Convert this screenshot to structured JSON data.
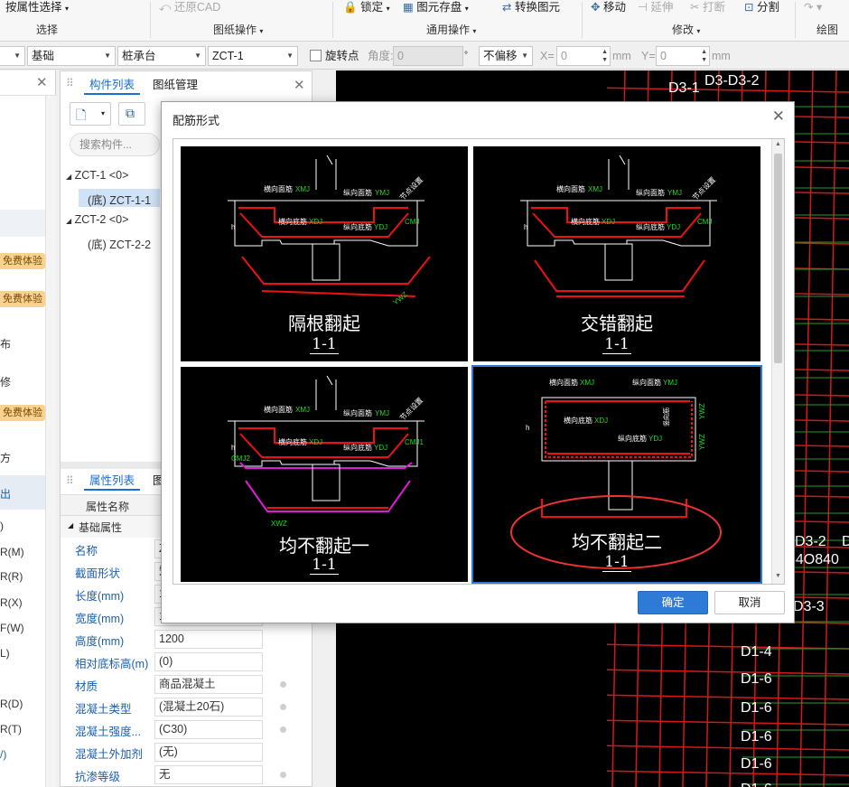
{
  "ribbon": {
    "attr_select": "按属性选择",
    "restore_cad": "还原CAD",
    "lock": "锁定",
    "save_elem": "图元存盘",
    "convert_elem": "转换图元",
    "move": "移动",
    "extend": "延伸",
    "break": "打断",
    "split": "分割",
    "groups": {
      "select": "选择",
      "drawing": "图纸操作",
      "common": "通用操作",
      "modify": "修改",
      "draw": "绘图"
    }
  },
  "toolbar": {
    "category": "基础",
    "type": "桩承台",
    "element": "ZCT-1",
    "rotate_point": "旋转点",
    "angle_label": "角度:",
    "angle_value": "0",
    "offset": "不偏移",
    "x_label": "X=",
    "x_value": "0",
    "y_label": "Y=",
    "y_value": "0",
    "unit": "mm"
  },
  "left_strip": {
    "badge": "免费体验",
    "items": [
      "布",
      "修",
      "方",
      "出",
      ")",
      "R(M)",
      "R(R)",
      "R(X)",
      "F(W)",
      "L)",
      "R(D)",
      "R(T)",
      "/)"
    ]
  },
  "component_panel": {
    "tabs": [
      "构件列表",
      "图纸管理"
    ],
    "search_placeholder": "搜索构件...",
    "tree": [
      {
        "label": "ZCT-1 <0>",
        "children": [
          "(底) ZCT-1-1"
        ]
      },
      {
        "label": "ZCT-2 <0>",
        "children": [
          "(底) ZCT-2-2"
        ]
      }
    ]
  },
  "property_panel": {
    "tabs": [
      "属性列表",
      "图"
    ],
    "header": "属性名称",
    "section": "基础属性",
    "rows": [
      {
        "name": "名称",
        "value": "Z"
      },
      {
        "name": "截面形状",
        "value": "矩"
      },
      {
        "name": "长度(mm)",
        "value": "1"
      },
      {
        "name": "宽度(mm)",
        "value": "1"
      },
      {
        "name": "高度(mm)",
        "value": "1200"
      },
      {
        "name": "相对底标高(m)",
        "value": "(0)"
      },
      {
        "name": "材质",
        "value": "商品混凝土"
      },
      {
        "name": "混凝土类型",
        "value": "(混凝土20石)"
      },
      {
        "name": "混凝土强度...",
        "value": "(C30)"
      },
      {
        "name": "混凝土外加剂",
        "value": "(无)"
      },
      {
        "name": "抗渗等级",
        "value": "无"
      }
    ]
  },
  "canvas_labels": [
    "D3-1",
    "D3-D3-2",
    "D3-2",
    "D3-D",
    "D1-4",
    "D1-6",
    "D1-6",
    "D1-6",
    "D1-6",
    "D1-6",
    "84O840",
    "D3-3"
  ],
  "dialog": {
    "title": "配筋形式",
    "options": [
      {
        "title": "隔根翻起",
        "section": "1-1"
      },
      {
        "title": "交错翻起",
        "section": "1-1"
      },
      {
        "title": "均不翻起一",
        "section": "1-1"
      },
      {
        "title": "均不翻起二",
        "section": "1-1"
      }
    ],
    "selected": 3,
    "rebar_labels": {
      "top_trans": "横向面筋",
      "top_trans_code": "XMJ",
      "top_long": "纵向面筋",
      "top_long_code": "YMJ",
      "bot_trans": "横向底筋",
      "bot_trans_code": "XDJ",
      "bot_long": "纵向底筋",
      "bot_long_code": "YDJ",
      "side": "侧面筋",
      "side_code": "CMJ",
      "erect": "竖向筋",
      "code_cmj1": "CMJ1",
      "code_cmj2": "CMJ2",
      "code_xwz": "XWZ",
      "code_ywz": "YWZ",
      "code_xdj": "XDJ",
      "code_xmj": "XMJ",
      "h": "h",
      "cover": "5d",
      "joint": "节点设置"
    },
    "ok": "确定",
    "cancel": "取消"
  }
}
